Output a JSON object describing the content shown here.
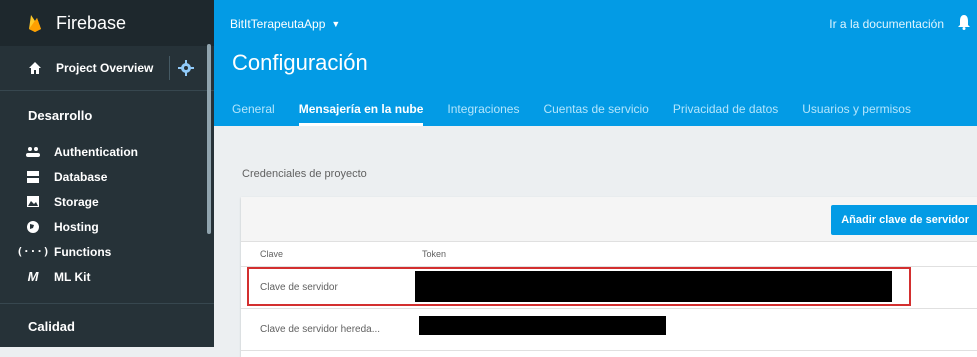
{
  "sidebar": {
    "brand": "Firebase",
    "overview_label": "Project Overview",
    "section_desarrollo": "Desarrollo",
    "items": [
      {
        "label": "Authentication",
        "icon": "people-icon"
      },
      {
        "label": "Database",
        "icon": "database-icon"
      },
      {
        "label": "Storage",
        "icon": "image-icon"
      },
      {
        "label": "Hosting",
        "icon": "globe-icon"
      },
      {
        "label": "Functions",
        "icon": "functions-icon"
      },
      {
        "label": "ML Kit",
        "icon": "mlkit-icon"
      }
    ],
    "section_calidad": "Calidad"
  },
  "topbar": {
    "project_name": "BitItTerapeutaApp",
    "docs_link": "Ir a la documentación",
    "title": "Configuración",
    "tabs": [
      {
        "label": "General"
      },
      {
        "label": "Mensajería en la nube"
      },
      {
        "label": "Integraciones"
      },
      {
        "label": "Cuentas de servicio"
      },
      {
        "label": "Privacidad de datos"
      },
      {
        "label": "Usuarios y permisos"
      }
    ],
    "active_tab": "Mensajería en la nube"
  },
  "content": {
    "section_title": "Credenciales de proyecto",
    "add_button": "Añadir clave de servidor",
    "table": {
      "headers": [
        "Clave",
        "Token"
      ],
      "rows": [
        {
          "clave": "Clave de servidor"
        },
        {
          "clave": "Clave de servidor hereda..."
        }
      ]
    }
  },
  "colors": {
    "accent": "#039be5",
    "sidebar": "#263238",
    "highlight": "#d32f2f"
  }
}
